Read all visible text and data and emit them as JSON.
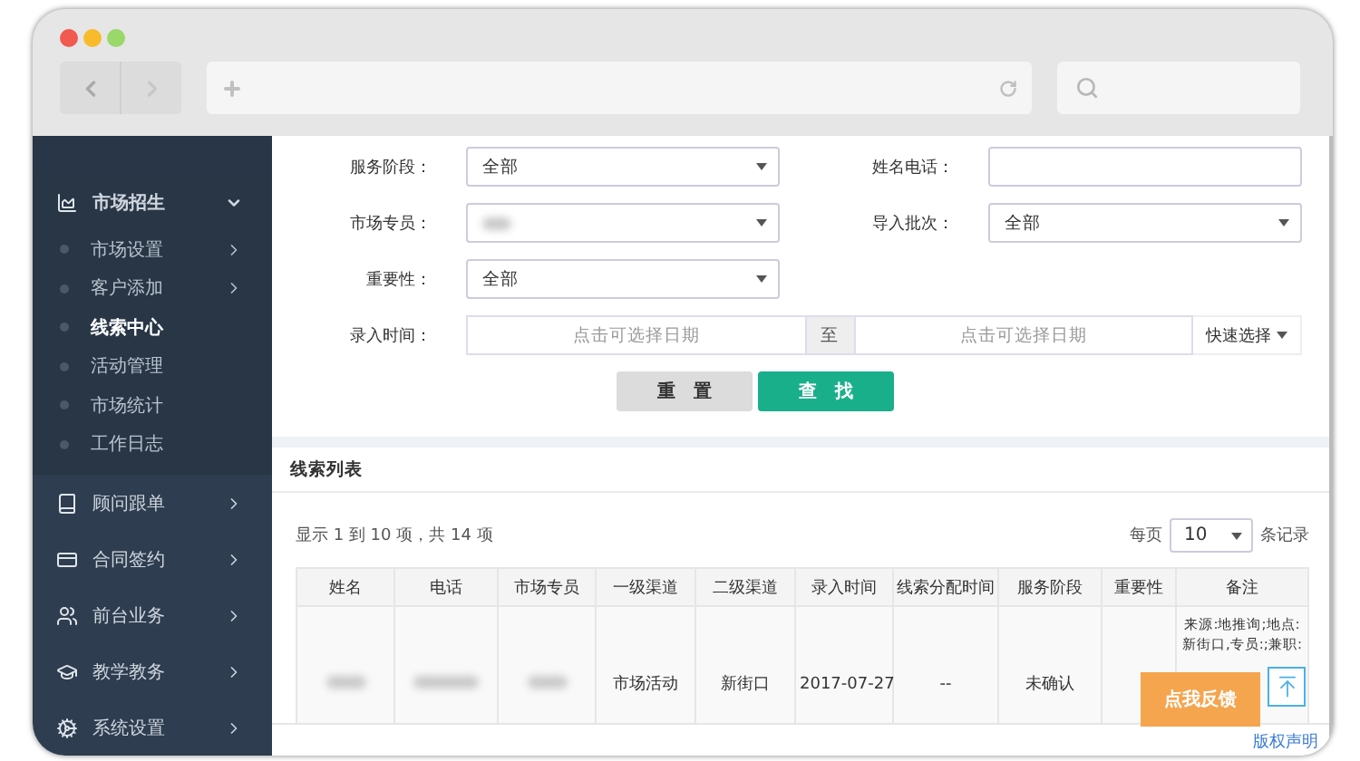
{
  "sidebar": {
    "groups": [
      {
        "label": "市场招生",
        "expanded": true,
        "items": [
          {
            "label": "市场设置",
            "has_submenu": true,
            "selected": false
          },
          {
            "label": "客户添加",
            "has_submenu": true,
            "selected": false
          },
          {
            "label": "线索中心",
            "has_submenu": false,
            "selected": true
          },
          {
            "label": "活动管理",
            "has_submenu": false,
            "selected": false
          },
          {
            "label": "市场统计",
            "has_submenu": false,
            "selected": false
          },
          {
            "label": "工作日志",
            "has_submenu": false,
            "selected": false
          }
        ]
      },
      {
        "label": "顾问跟单",
        "expanded": false
      },
      {
        "label": "合同签约",
        "expanded": false
      },
      {
        "label": "前台业务",
        "expanded": false
      },
      {
        "label": "教学教务",
        "expanded": false
      },
      {
        "label": "系统设置",
        "expanded": false
      }
    ]
  },
  "form": {
    "fields": [
      {
        "kind": "select",
        "label": "服务阶段：",
        "value": "全部"
      },
      {
        "kind": "text",
        "label": "姓名电话："
      },
      {
        "kind": "select",
        "label": "市场专员：",
        "redacted": true
      },
      {
        "kind": "select",
        "label": "导入批次：",
        "value": "全部"
      },
      {
        "kind": "select",
        "label": "重要性：",
        "value": "全部"
      }
    ],
    "date_range": {
      "label": "录入时间：",
      "from_placeholder": "点击可选择日期",
      "separator": "至",
      "to_placeholder": "点击可选择日期",
      "quick_select": "快速选择"
    },
    "buttons": [
      {
        "kind": "reset",
        "label": "重　置"
      },
      {
        "kind": "search",
        "label": "查　找"
      }
    ]
  },
  "list": {
    "title": "线索列表",
    "summary": "显示 1 到 10 项，共 14 项",
    "page_size_label": "每页",
    "page_size": "10",
    "page_size_unit": "条记录",
    "columns": [
      "姓名",
      "电话",
      "市场专员",
      "一级渠道",
      "二级渠道",
      "录入时间",
      "线索分配时间",
      "服务阶段",
      "重要性",
      "备注"
    ],
    "rows": [
      {
        "cells": [
          {
            "redacted": true
          },
          {
            "redacted": true
          },
          {
            "redacted": true
          },
          {
            "text": "市场活动"
          },
          {
            "text": "新街口"
          },
          {
            "text": "2017-07-27"
          },
          {
            "text": "--"
          },
          {
            "text": "未确认"
          },
          {
            "text": ""
          },
          {
            "text": "来源:地推询;地点:新街口,专员:;兼职:"
          }
        ]
      }
    ]
  },
  "feedback_button": "点我反馈",
  "footer_link": "版权声明"
}
